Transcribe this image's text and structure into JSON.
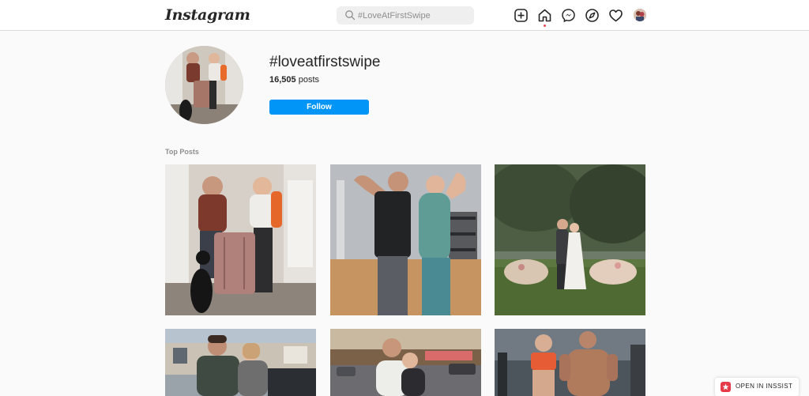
{
  "header": {
    "logo": "Instagram",
    "search": {
      "placeholder": "#LoveAtFirstSwipe"
    },
    "nav_icons": [
      "new-post-icon",
      "home-icon",
      "messenger-icon",
      "explore-icon",
      "activity-heart-icon",
      "profile-avatar"
    ]
  },
  "profile": {
    "hashtag": "#loveatfirstswipe",
    "post_count": "16,505",
    "posts_suffix": " posts",
    "follow_label": "Follow"
  },
  "top_posts": {
    "label": "Top Posts"
  },
  "extension": {
    "label": "OPEN IN INSSIST"
  },
  "colors": {
    "accent": "#0095f6",
    "notification": "#ed4956",
    "insist_brand": "#e53a48"
  }
}
